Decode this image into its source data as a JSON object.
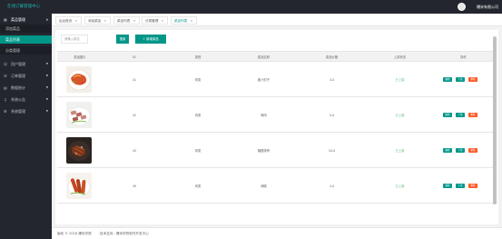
{
  "app": {
    "title": "在线订餐管理中心",
    "user": "爆米有限公司"
  },
  "sidebar": {
    "items": [
      {
        "label": "菜品管理",
        "icon": "grid-icon",
        "arrow": "▲"
      },
      {
        "label": "添加菜品"
      },
      {
        "label": "菜品列表"
      },
      {
        "label": "分类管理"
      },
      {
        "label": "用户管理",
        "icon": "user-icon",
        "arrow": "▼"
      },
      {
        "label": "订单管理",
        "icon": "order-icon",
        "arrow": "▼"
      },
      {
        "label": "数据统计",
        "icon": "chart-icon",
        "arrow": "▼"
      },
      {
        "label": "系统公告",
        "icon": "bell-icon",
        "arrow": "▼"
      },
      {
        "label": "系统管理",
        "icon": "gear-icon",
        "arrow": "▼"
      }
    ]
  },
  "tabs": [
    {
      "label": "后台首页"
    },
    {
      "label": "添加菜品"
    },
    {
      "label": "菜品列表"
    },
    {
      "label": "分类管理"
    },
    {
      "label": "菜品列表"
    }
  ],
  "toolbar": {
    "search_placeholder": "请输入菜名",
    "search_label": "搜索",
    "add_label": "+ 新增菜品"
  },
  "table": {
    "columns": [
      "菜品图片",
      "ID",
      "类别",
      "菜品名称",
      "菜品价格",
      "上架状态",
      "操作"
    ],
    "rows": [
      {
        "id": "41",
        "category": "肉类",
        "name": "酱汁肘子",
        "price": "4.0",
        "status": "已上架",
        "thumb": "chicken-dish"
      },
      {
        "id": "42",
        "category": "肉类",
        "name": "鸭肉",
        "price": "5.0",
        "status": "已上架",
        "thumb": "duck-slices"
      },
      {
        "id": "43",
        "category": "肉类",
        "name": "糖醋排骨",
        "price": "10.0",
        "status": "已上架",
        "thumb": "ribs-dish"
      },
      {
        "id": "49",
        "category": "肉类",
        "name": "烤肠",
        "price": "4.0",
        "status": "已上架",
        "thumb": "sausage-dish"
      }
    ],
    "actions": {
      "edit": "编辑",
      "down": "下架",
      "delete": "删除"
    }
  },
  "footer": {
    "copyright": "版权 © 2018 爆米学院",
    "support": "技术支持：爆米学院软件开发中心"
  },
  "colors": {
    "accent": "#009688",
    "danger": "#FF5722",
    "sidebar": "#23262e",
    "status": "#5FB878"
  }
}
